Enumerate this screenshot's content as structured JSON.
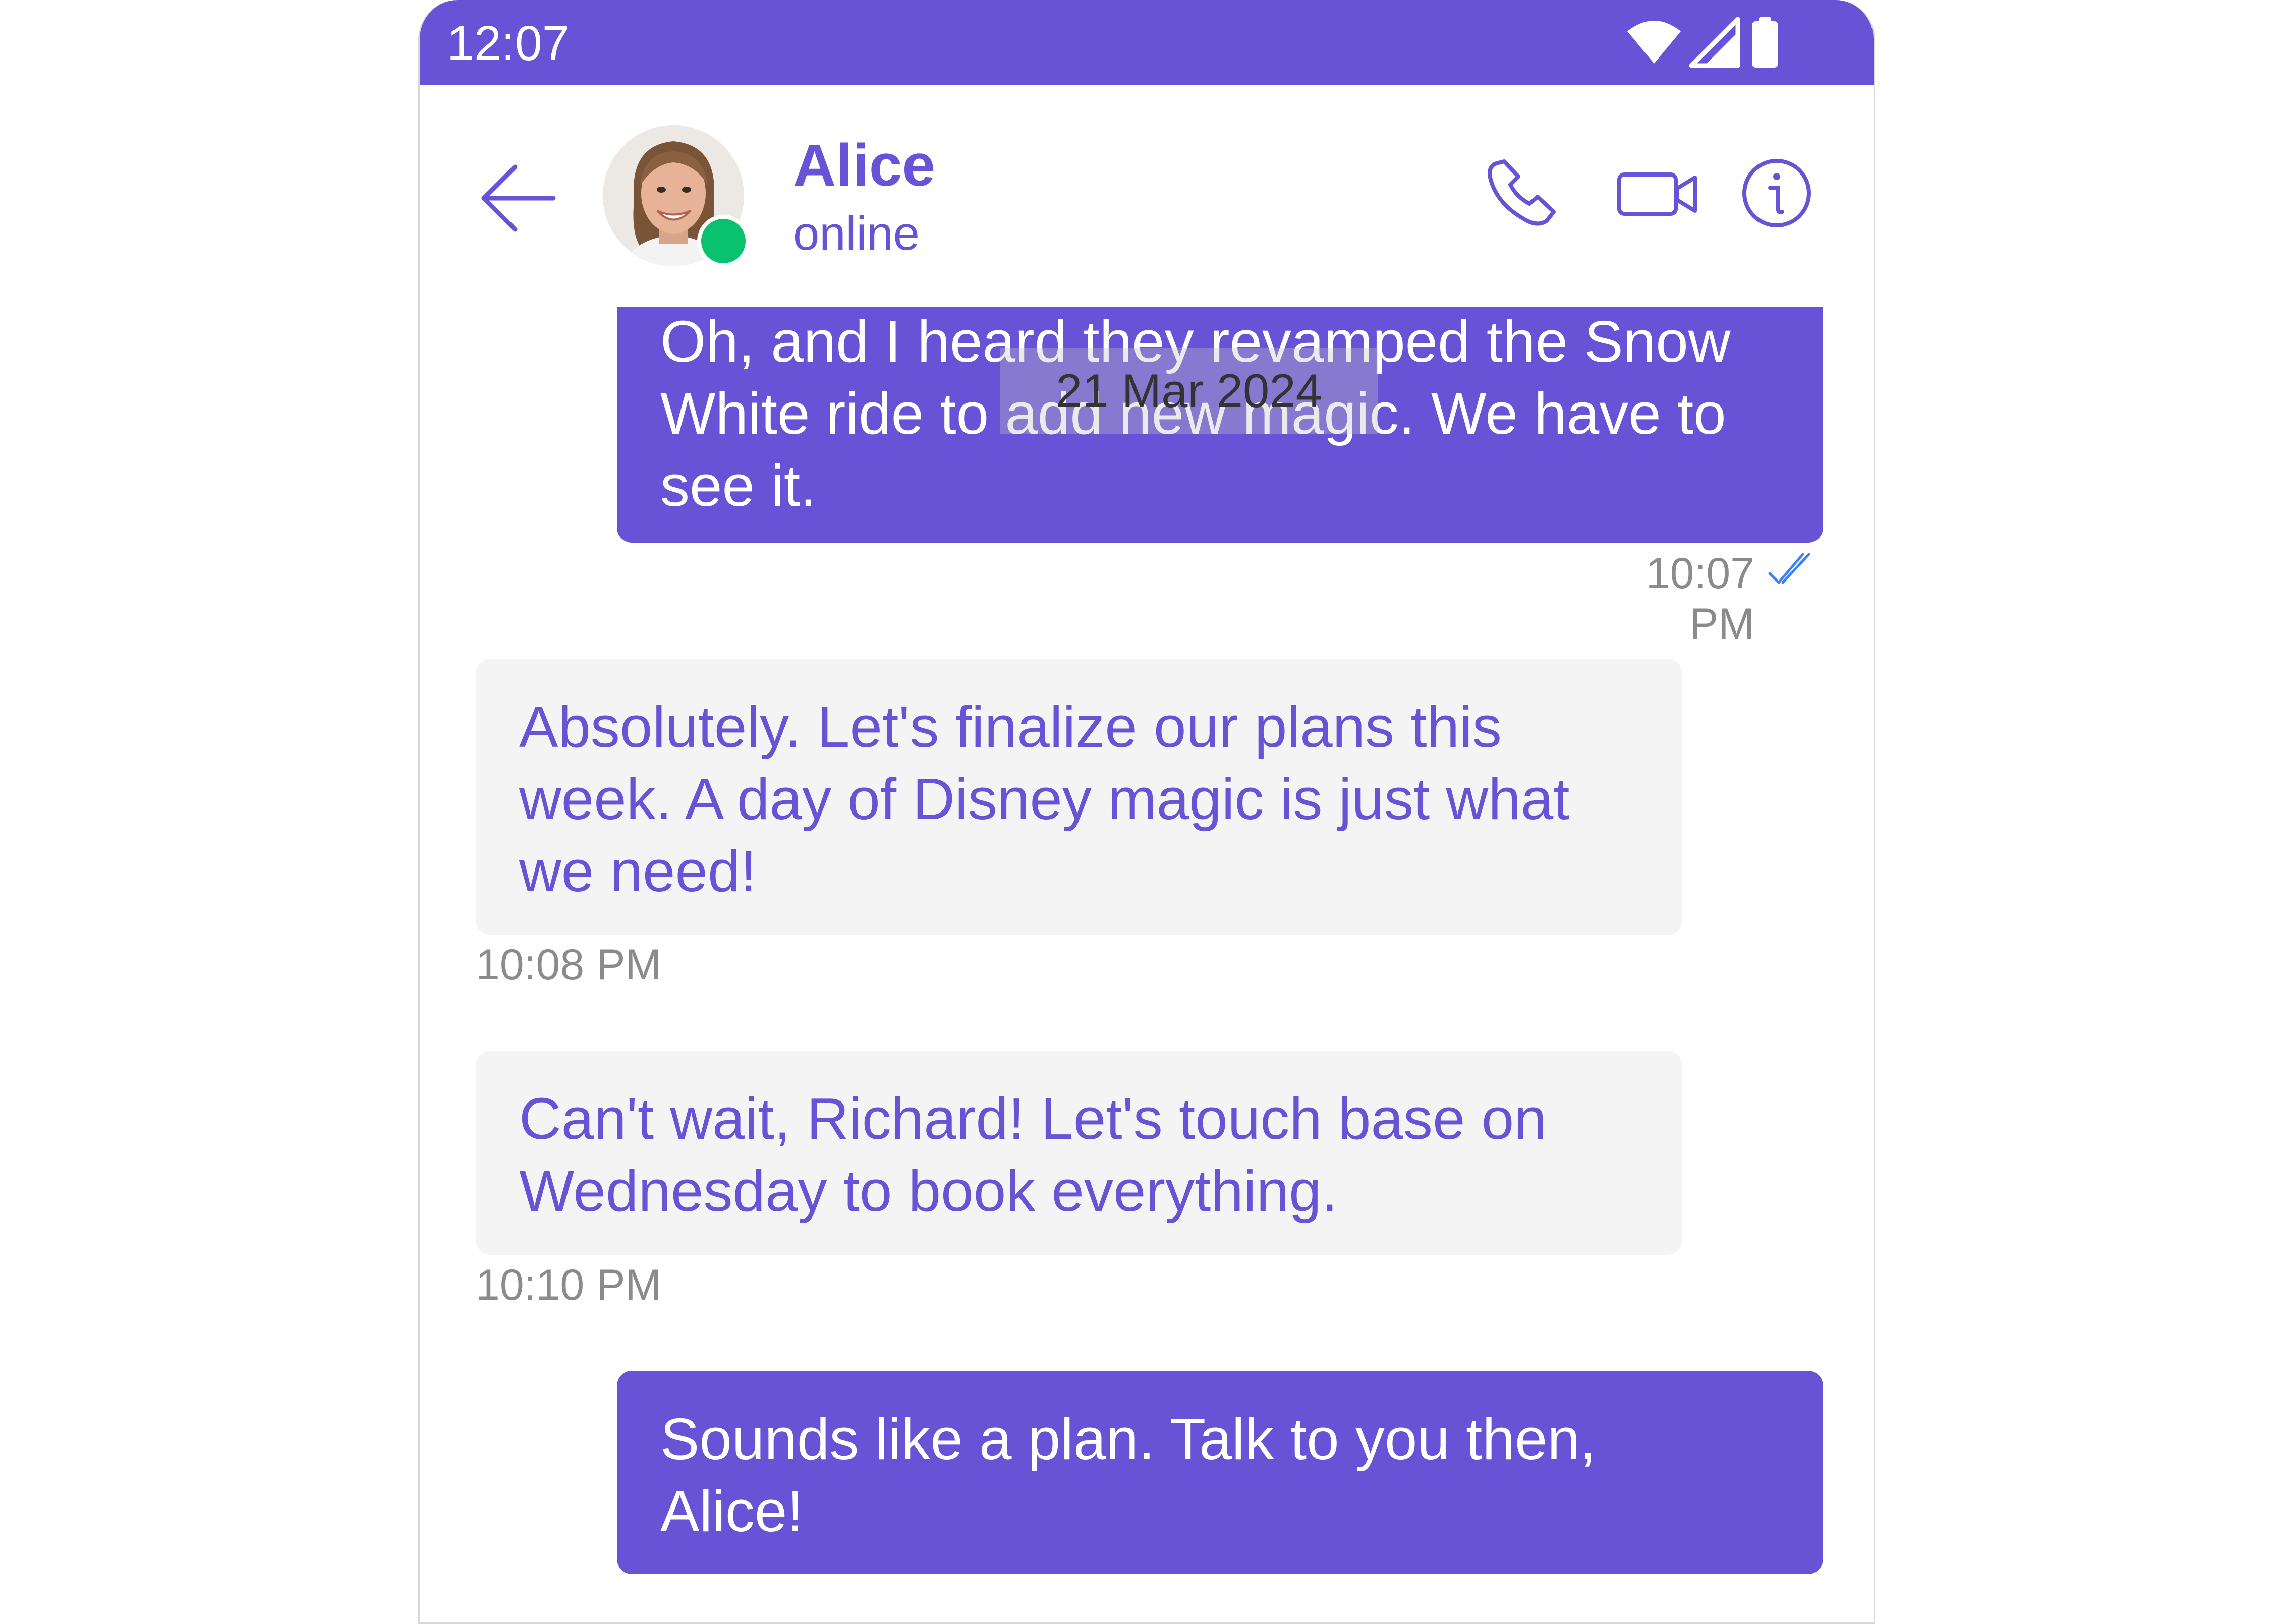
{
  "status_bar": {
    "time": "12:07",
    "icons": [
      "wifi-icon",
      "signal-icon",
      "battery-icon"
    ],
    "background": "#6852D6"
  },
  "header": {
    "back_icon": "arrow-left-icon",
    "contact_name": "Alice",
    "contact_status": "online",
    "presence_color": "#09C26F",
    "actions": [
      "phone-icon",
      "video-icon",
      "info-icon"
    ]
  },
  "date_separator": "21 Mar 2024",
  "messages": [
    {
      "direction": "outgoing",
      "lines": [
        "Oh, and I heard they revamped the Snow",
        "White ride to add new magic. We have to",
        "see it."
      ],
      "time": "10:07 PM",
      "receipt": "read-receipt-icon"
    },
    {
      "direction": "incoming",
      "lines": [
        "Absolutely. Let's finalize our plans this",
        "week. A day of Disney magic is just what",
        "we need!"
      ],
      "time": "10:08 PM"
    },
    {
      "direction": "incoming",
      "lines": [
        "Can't wait, Richard! Let's touch base on",
        "Wednesday to book everything."
      ],
      "time": "10:10 PM"
    },
    {
      "direction": "outgoing",
      "lines": [
        "Sounds like a plan. Talk to you then,",
        "Alice!"
      ]
    }
  ],
  "colors": {
    "primary": "#6852D6",
    "incoming_bubble": "#F4F4F4",
    "receipt": "#3B82F6"
  }
}
